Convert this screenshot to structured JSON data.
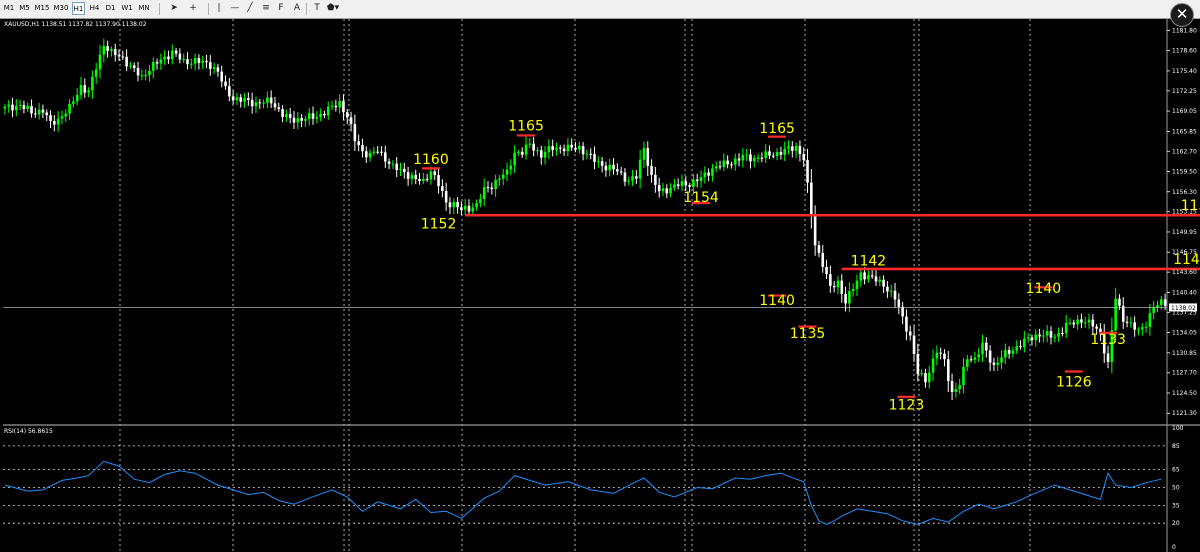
{
  "toolbar": {
    "timeframes": [
      "M1",
      "M5",
      "M15",
      "M30",
      "H1",
      "H4",
      "D1",
      "W1",
      "MN"
    ],
    "active_timeframe": "H1",
    "tools": [
      {
        "name": "cursor-icon",
        "glyph": "➤"
      },
      {
        "name": "crosshair-icon",
        "glyph": "+"
      },
      {
        "name": "vertical-line-icon",
        "glyph": "|"
      },
      {
        "name": "horizontal-line-icon",
        "glyph": "—"
      },
      {
        "name": "trendline-icon",
        "glyph": "╱"
      },
      {
        "name": "channel-icon",
        "glyph": "≡"
      },
      {
        "name": "fibonacci-icon",
        "glyph": "F"
      },
      {
        "name": "text-icon",
        "glyph": "A"
      },
      {
        "name": "label-icon",
        "glyph": "T"
      },
      {
        "name": "shapes-icon",
        "glyph": "⬟▾"
      }
    ]
  },
  "close_glyph": "✕",
  "chart_data": {
    "type": "candlestick",
    "symbol_header": "XAUUSD,H1  1138.51 1137.82 1137.90 1138.02",
    "ylim": [
      1119.6,
      1183.6
    ],
    "y_ticks": [
      "1181.80",
      "1178.60",
      "1175.40",
      "1172.25",
      "1169.05",
      "1165.85",
      "1162.70",
      "1159.50",
      "1156.30",
      "1153.15",
      "1149.95",
      "1146.75",
      "1143.60",
      "1140.40",
      "1137.25",
      "1134.05",
      "1130.85",
      "1127.70",
      "1124.50",
      "1121.30"
    ],
    "current_price": "1138.02",
    "colors": {
      "bull": "#00ff00",
      "bear": "#ffffff",
      "level": "#ff2b2b",
      "annotation": "#ffff00",
      "rsi": "#1e90ff",
      "grid": "#ffffff",
      "axis_text": "#ffffff"
    },
    "close_path": [
      [
        0,
        1169.5
      ],
      [
        4,
        1170
      ],
      [
        7,
        1168.8
      ],
      [
        10,
        1169.2
      ],
      [
        12,
        1167
      ],
      [
        14,
        1167.8
      ],
      [
        17,
        1169.5
      ],
      [
        20,
        1173
      ],
      [
        22,
        1172
      ],
      [
        24,
        1176
      ],
      [
        26,
        1179.6
      ],
      [
        28,
        1178.2
      ],
      [
        31,
        1177.5
      ],
      [
        33,
        1176
      ],
      [
        36,
        1174.4
      ],
      [
        38,
        1175.8
      ],
      [
        42,
        1177.5
      ],
      [
        44,
        1178.4
      ],
      [
        47,
        1176.8
      ],
      [
        50,
        1177
      ],
      [
        54,
        1176.4
      ],
      [
        56,
        1175.2
      ],
      [
        58,
        1172.4
      ],
      [
        60,
        1171.1
      ],
      [
        62,
        1170.8
      ],
      [
        66,
        1170.3
      ],
      [
        70,
        1170.6
      ],
      [
        73,
        1168.5
      ],
      [
        75,
        1167.7
      ],
      [
        78,
        1167.8
      ],
      [
        82,
        1168.2
      ],
      [
        86,
        1169.6
      ],
      [
        88,
        1170.4
      ],
      [
        90,
        1168.2
      ],
      [
        92,
        1164.5
      ],
      [
        94,
        1162.7
      ],
      [
        96,
        1162
      ],
      [
        98,
        1162.8
      ],
      [
        100,
        1161.6
      ],
      [
        102,
        1160.2
      ],
      [
        105,
        1159.4
      ],
      [
        108,
        1158.2
      ],
      [
        110,
        1157.9
      ],
      [
        112,
        1159.7
      ],
      [
        114,
        1157.4
      ],
      [
        116,
        1154.6
      ],
      [
        118,
        1154.4
      ],
      [
        120,
        1153.4
      ],
      [
        122,
        1153.7
      ],
      [
        124,
        1154.3
      ],
      [
        126,
        1156.5
      ],
      [
        128,
        1157.3
      ],
      [
        130,
        1158.6
      ],
      [
        132,
        1159.2
      ],
      [
        134,
        1162.6
      ],
      [
        136,
        1162.5
      ],
      [
        138,
        1163.8
      ],
      [
        141,
        1162.1
      ],
      [
        144,
        1163.3
      ],
      [
        148,
        1163.1
      ],
      [
        151,
        1163.3
      ],
      [
        154,
        1161.7
      ],
      [
        158,
        1160.2
      ],
      [
        161,
        1159.6
      ],
      [
        164,
        1158
      ],
      [
        166,
        1158.6
      ],
      [
        168,
        1163.4
      ],
      [
        170,
        1158.5
      ],
      [
        172,
        1156.3
      ],
      [
        174,
        1156.7
      ],
      [
        177,
        1157.4
      ],
      [
        180,
        1157.6
      ],
      [
        183,
        1158.4
      ],
      [
        186,
        1160
      ],
      [
        190,
        1160.8
      ],
      [
        194,
        1161.8
      ],
      [
        197,
        1161.6
      ],
      [
        200,
        1162
      ],
      [
        203,
        1162.4
      ],
      [
        206,
        1163
      ],
      [
        208,
        1163.4
      ],
      [
        210,
        1161.6
      ],
      [
        213,
        1148
      ],
      [
        215,
        1145
      ],
      [
        217,
        1141
      ],
      [
        219,
        1142
      ],
      [
        221,
        1139
      ],
      [
        223,
        1141
      ],
      [
        225,
        1143.4
      ],
      [
        228,
        1142.6
      ],
      [
        231,
        1141.7
      ],
      [
        234,
        1139.4
      ],
      [
        236,
        1136.4
      ],
      [
        238,
        1133.4
      ],
      [
        240,
        1127.6
      ],
      [
        242,
        1126.6
      ],
      [
        245,
        1131.1
      ],
      [
        247,
        1129.6
      ],
      [
        249,
        1124.5
      ],
      [
        251,
        1125.8
      ],
      [
        253,
        1130.2
      ],
      [
        255,
        1129.9
      ],
      [
        257,
        1132
      ],
      [
        260,
        1128.8
      ],
      [
        262,
        1130.2
      ],
      [
        265,
        1131.4
      ],
      [
        269,
        1133
      ],
      [
        272,
        1133.8
      ],
      [
        276,
        1133.4
      ],
      [
        279,
        1135.1
      ],
      [
        283,
        1136.1
      ],
      [
        286,
        1135.2
      ],
      [
        288,
        1133.8
      ],
      [
        290,
        1129
      ],
      [
        292,
        1139.5
      ],
      [
        294,
        1136.3
      ],
      [
        296,
        1135.2
      ],
      [
        298,
        1134.2
      ],
      [
        300,
        1135.6
      ],
      [
        302,
        1138
      ],
      [
        304,
        1138.8
      ]
    ],
    "levels": [
      {
        "price": 1152.6,
        "from": 121,
        "to": 319,
        "label": "1152"
      },
      {
        "price": 1144.1,
        "from": 220,
        "to": 317,
        "label": "1142"
      }
    ],
    "annotations": [
      {
        "label": "1160",
        "bar": 112,
        "price": 1161.5,
        "marker": 1160.0
      },
      {
        "label": "1165",
        "bar": 137,
        "price": 1166.8,
        "marker": 1165.2
      },
      {
        "label": "1165",
        "bar": 203,
        "price": 1166.4,
        "marker": 1165.0
      },
      {
        "label": "1152",
        "bar": 114,
        "price": 1151.3,
        "marker": null
      },
      {
        "label": "1154",
        "bar": 183,
        "price": 1155.5,
        "marker": 1154.5
      },
      {
        "label": "1142",
        "bar": 227,
        "price": 1145.4,
        "marker": null
      },
      {
        "label": "1140",
        "bar": 203,
        "price": 1139.2,
        "marker": 1139.9
      },
      {
        "label": "1135",
        "bar": 211,
        "price": 1134.0,
        "marker": 1135.0
      },
      {
        "label": "1123",
        "bar": 237,
        "price": 1122.7,
        "marker": 1123.9
      },
      {
        "label": "1140",
        "bar": 273,
        "price": 1141.1,
        "marker": 1141.2
      },
      {
        "label": "1133",
        "bar": 290,
        "price": 1133.0,
        "marker": 1134.0
      },
      {
        "label": "1126",
        "bar": 281,
        "price": 1126.3,
        "marker": 1127.9
      }
    ],
    "rsi": {
      "label": "RSI(14) 56.8615",
      "y_ticks": [
        "100",
        "85",
        "65",
        "50",
        "35",
        "20",
        "0"
      ],
      "series_points": [
        [
          0,
          52
        ],
        [
          6,
          47
        ],
        [
          10,
          48
        ],
        [
          15,
          56
        ],
        [
          19,
          58
        ],
        [
          22,
          60
        ],
        [
          26,
          72
        ],
        [
          30,
          68
        ],
        [
          34,
          57
        ],
        [
          38,
          54
        ],
        [
          42,
          61
        ],
        [
          46,
          64
        ],
        [
          50,
          62
        ],
        [
          56,
          52
        ],
        [
          60,
          48
        ],
        [
          64,
          44
        ],
        [
          68,
          46
        ],
        [
          72,
          39
        ],
        [
          76,
          36
        ],
        [
          80,
          41
        ],
        [
          86,
          48
        ],
        [
          90,
          42
        ],
        [
          94,
          30
        ],
        [
          98,
          38
        ],
        [
          104,
          32
        ],
        [
          108,
          40
        ],
        [
          112,
          29
        ],
        [
          116,
          30
        ],
        [
          120,
          24
        ],
        [
          126,
          41
        ],
        [
          130,
          47
        ],
        [
          134,
          60
        ],
        [
          138,
          56
        ],
        [
          142,
          52
        ],
        [
          148,
          55
        ],
        [
          154,
          48
        ],
        [
          160,
          45
        ],
        [
          166,
          55
        ],
        [
          168,
          58
        ],
        [
          172,
          46
        ],
        [
          176,
          42
        ],
        [
          182,
          50
        ],
        [
          186,
          49
        ],
        [
          192,
          58
        ],
        [
          196,
          57
        ],
        [
          200,
          60
        ],
        [
          204,
          62
        ],
        [
          208,
          57
        ],
        [
          210,
          55
        ],
        [
          212,
          35
        ],
        [
          214,
          22
        ],
        [
          216,
          19
        ],
        [
          218,
          22
        ],
        [
          220,
          26
        ],
        [
          224,
          32
        ],
        [
          228,
          30
        ],
        [
          232,
          28
        ],
        [
          236,
          22
        ],
        [
          240,
          19
        ],
        [
          244,
          24
        ],
        [
          248,
          21
        ],
        [
          252,
          30
        ],
        [
          256,
          36
        ],
        [
          260,
          32
        ],
        [
          266,
          38
        ],
        [
          270,
          44
        ],
        [
          276,
          52
        ],
        [
          280,
          48
        ],
        [
          284,
          44
        ],
        [
          288,
          40
        ],
        [
          290,
          62
        ],
        [
          292,
          52
        ],
        [
          296,
          50
        ],
        [
          300,
          54
        ],
        [
          304,
          57
        ]
      ]
    }
  }
}
